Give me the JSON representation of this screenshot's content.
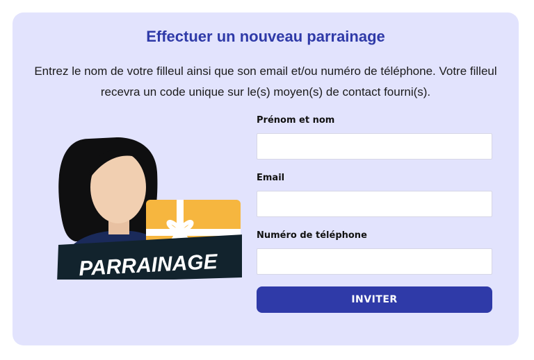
{
  "card": {
    "title": "Effectuer un nouveau parrainage",
    "intro": "Entrez le nom de votre filleul ainsi que son email et/ou numéro de téléphone. Votre filleul recevra un code unique sur le(s) moyen(s) de contact fourni(s)."
  },
  "illustration": {
    "banner_text": "PARRAINAGE"
  },
  "form": {
    "name_label": "Prénom et nom",
    "name_value": "",
    "email_label": "Email",
    "email_value": "",
    "phone_label": "Numéro de téléphone",
    "phone_value": "",
    "submit_label": "INVITER"
  },
  "colors": {
    "card_background": "#e2e3fd",
    "accent": "#2f3aa8",
    "gift": "#f6b63f",
    "banner": "#12232d"
  }
}
